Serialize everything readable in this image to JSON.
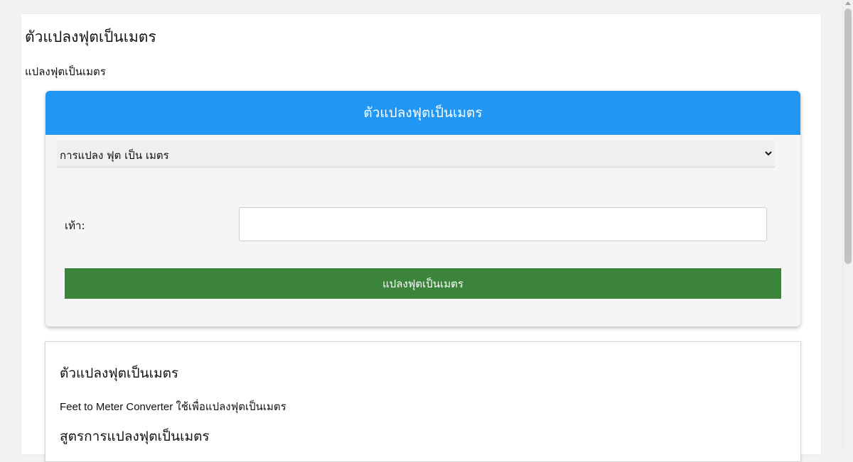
{
  "page": {
    "title": "ตัวแปลงฟุตเป็นเมตร",
    "subtitle": "แปลงฟุตเป็นเมตร"
  },
  "converter": {
    "header": "ตัวแปลงฟุตเป็นเมตร",
    "select": {
      "selected": "การแปลง ฟุต เป็น เมตร",
      "icon": "chevron-down-icon"
    },
    "feet_label": "เท้า:",
    "feet_value": "",
    "feet_placeholder": "",
    "button_label": "แปลงฟุตเป็นเมตร"
  },
  "info": {
    "heading": "ตัวแปลงฟุตเป็นเมตร",
    "text": "Feet to Meter Converter ใช้เพื่อแปลงฟุตเป็นเมตร",
    "formula_heading": "สูตรการแปลงฟุตเป็นเมตร"
  },
  "colors": {
    "header_blue": "#2196f3",
    "button_green": "#3c843c"
  }
}
